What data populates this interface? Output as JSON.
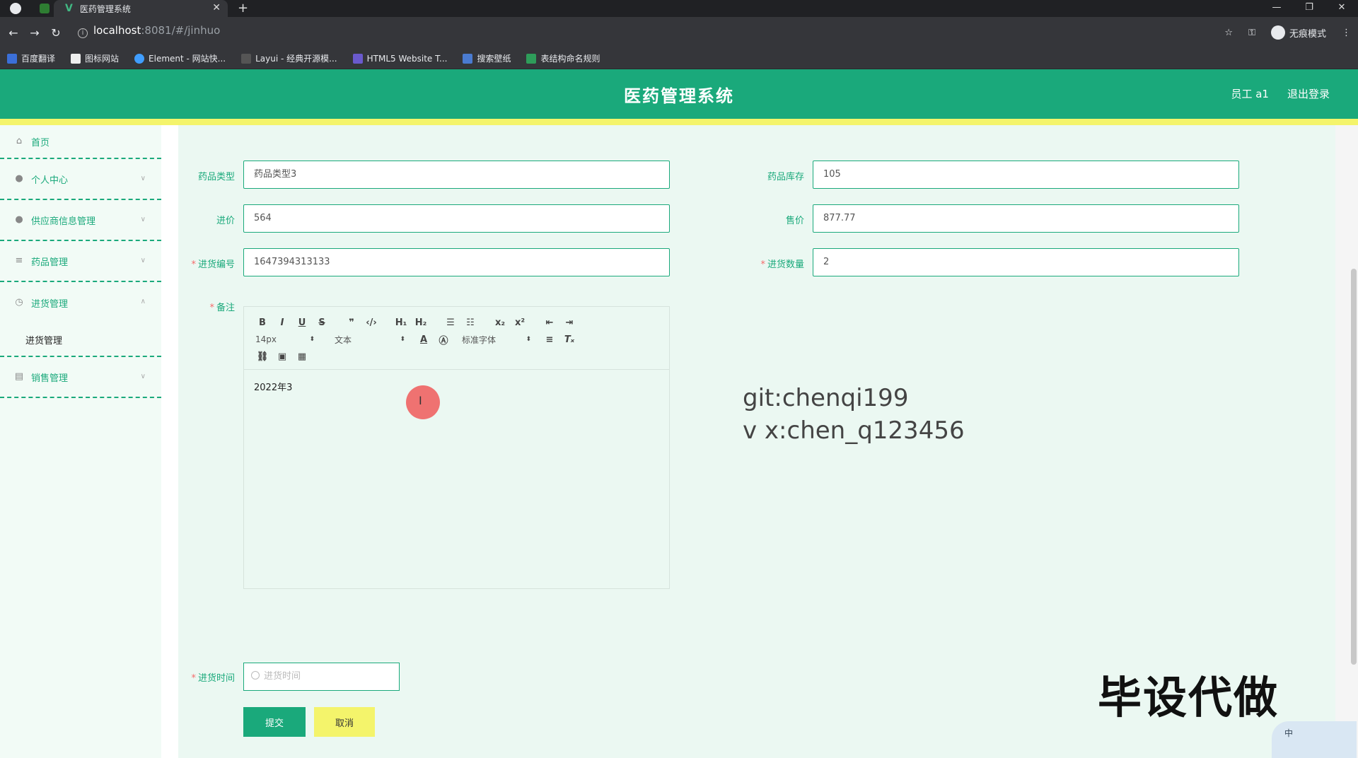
{
  "browser": {
    "tab_title": "医药管理系统",
    "url_host": "localhost",
    "url_rest": ":8081/#/jinhuo",
    "profile_label": "无痕模式",
    "bookmarks": [
      "百度翻译",
      "图标网站",
      "Element - 网站快...",
      "Layui - 经典开源模...",
      "HTML5 Website T...",
      "搜索壁纸",
      "表结构命名规则"
    ]
  },
  "header": {
    "title": "医药管理系统",
    "user": "员工 a1",
    "logout": "退出登录"
  },
  "sidebar": {
    "items": [
      {
        "label": "首页"
      },
      {
        "label": "个人中心"
      },
      {
        "label": "供应商信息管理"
      },
      {
        "label": "药品管理"
      },
      {
        "label": "进货管理"
      },
      {
        "label": "销售管理"
      }
    ],
    "submenu": "进货管理"
  },
  "form": {
    "drug_type": {
      "label": "药品类型",
      "value": "药品类型3"
    },
    "stock": {
      "label": "药品库存",
      "value": "105"
    },
    "purchase_price": {
      "label": "进价",
      "value": "564"
    },
    "sale_price": {
      "label": "售价",
      "value": "877.77"
    },
    "purchase_no": {
      "label": "进货编号",
      "value": "1647394313133"
    },
    "quantity": {
      "label": "进货数量",
      "value": "2"
    },
    "remark": {
      "label": "备注",
      "content": "2022年3"
    },
    "purchase_time": {
      "label": "进货时间",
      "placeholder": "进货时间"
    },
    "required_mark": "*"
  },
  "editor_toolbar": {
    "font_size": "14px",
    "block": "文本",
    "font_family": "标准字体"
  },
  "buttons": {
    "submit": "提交",
    "cancel": "取消"
  },
  "overlay": {
    "line1": "git:chenqi199",
    "line2": "v x:chen_q123456",
    "banner": "毕设代做",
    "ime": "中"
  },
  "colors": {
    "primary": "#1aa97b",
    "accent_yellow": "#f4f46b",
    "required": "#f56c6c"
  }
}
